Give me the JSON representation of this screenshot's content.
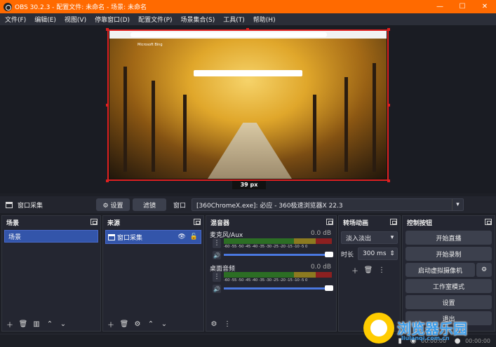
{
  "window": {
    "title": "OBS 30.2.3 - 配置文件: 未命名 - 场景: 未命名",
    "minimize": "—",
    "maximize": "☐",
    "close": "✕",
    "accent": "#ff6a00"
  },
  "menu": [
    "文件(F)",
    "编辑(E)",
    "视图(V)",
    "停靠窗口(D)",
    "配置文件(P)",
    "场景集合(S)",
    "工具(T)",
    "帮助(H)"
  ],
  "preview": {
    "browser_logo": "Microsoft Bing",
    "size_label": "39 px"
  },
  "source_toolbar": {
    "source_name": "窗口采集",
    "settings_label": "⚙ 设置",
    "filters_label": "滤镜",
    "window_label": "窗口",
    "window_value": "[360ChromeX.exe]: 必应 - 360极速浏览器X 22.3",
    "arrow": "▾"
  },
  "scenes": {
    "title": "场景",
    "items": [
      "场景"
    ]
  },
  "sources": {
    "title": "来源",
    "items": [
      "窗口采集"
    ]
  },
  "mixer": {
    "title": "混音器",
    "channels": [
      {
        "name": "麦克风/Aux",
        "db": "0.0 dB"
      },
      {
        "name": "桌面音频",
        "db": "0.0 dB"
      }
    ],
    "ticks": "-60 -55 -50 -45 -40 -35 -30 -25 -20 -15 -10 -5 0"
  },
  "transitions": {
    "title": "转场动画",
    "type": "淡入淡出",
    "duration_label": "时长",
    "duration_value": "300 ms"
  },
  "controls": {
    "title": "控制按钮",
    "buttons": [
      "开始直播",
      "开始录制",
      "启动虚拟摄像机",
      "工作室模式",
      "设置",
      "退出"
    ]
  },
  "status": {
    "time1": "00:00:00",
    "time2": "00:00:00"
  },
  "watermark": {
    "text": "浏览器乐园",
    "url": "liulanqi.com.cn"
  }
}
